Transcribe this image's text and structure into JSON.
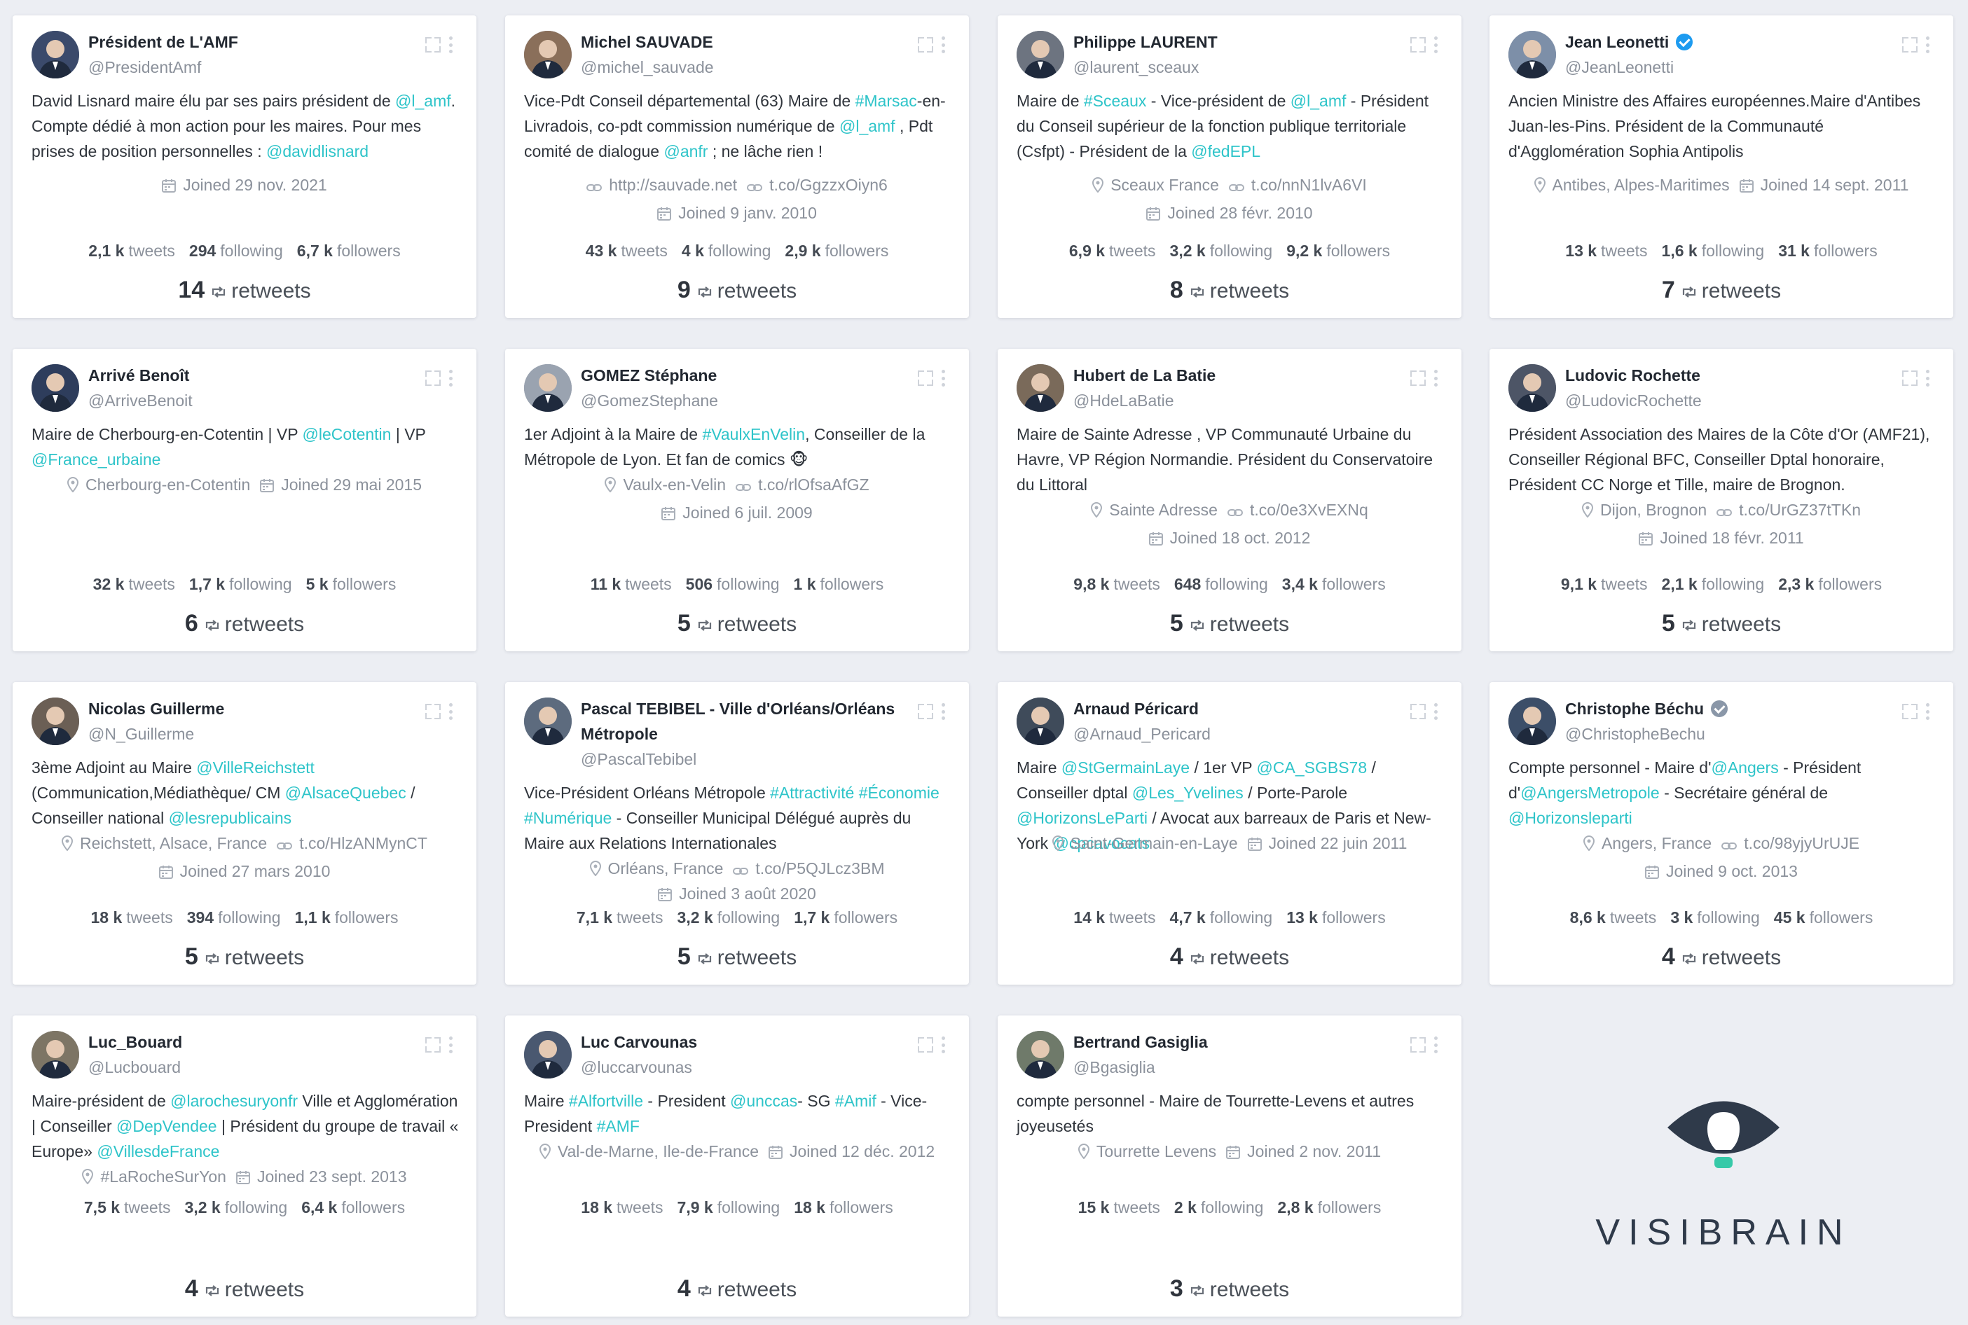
{
  "colors": {
    "background": "#eceef3",
    "card": "#ffffff",
    "highlight": "#2ec4c9",
    "muted": "#8b919b",
    "verified_blue": "#1d9bf0",
    "verified_gray": "#8a97a8"
  },
  "icons": {
    "card_actions": [
      "expand-icon",
      "more-icon"
    ],
    "location": "pin-icon",
    "url": "link-icon",
    "joined": "calendar-icon",
    "retweets": "retweet-icon"
  },
  "labels": {
    "tweets": "tweets",
    "following": "following",
    "followers": "followers",
    "retweets": "retweets"
  },
  "cards": [
    {
      "name": "Président de L'AMF",
      "verified": "",
      "handle": "@PresidentAmf",
      "bio": [
        {
          "t": "David Lisnard maire élu par ses pairs président de "
        },
        {
          "t": "@l_amf",
          "h": 1
        },
        {
          "t": ". Compte dédié à mon action pour les maires. Pour mes prises de position personnelles : "
        },
        {
          "t": "@davidlisnard",
          "h": 1
        }
      ],
      "location": "",
      "url": "",
      "joined": "Joined 29 nov. 2021",
      "tweets": "2,1 k",
      "following": "294",
      "followers": "6,7 k",
      "retweets": "14"
    },
    {
      "name": "Michel SAUVADE",
      "verified": "",
      "handle": "@michel_sauvade",
      "bio": [
        {
          "t": "Vice-Pdt Conseil départemental (63) Maire de "
        },
        {
          "t": "#Marsac",
          "h": 1
        },
        {
          "t": "-en-Livradois, co-pdt commission numérique de "
        },
        {
          "t": "@l_amf",
          "h": 1
        },
        {
          "t": " , Pdt comité de dialogue "
        },
        {
          "t": "@anfr",
          "h": 1
        },
        {
          "t": " ; ne lâche rien !"
        }
      ],
      "location": "",
      "url": "http://sauvade.net",
      "url2": "t.co/GgzzxOiyn6",
      "joined": "Joined 9 janv. 2010",
      "tweets": "43 k",
      "following": "4 k",
      "followers": "2,9 k",
      "retweets": "9"
    },
    {
      "name": "Philippe LAURENT",
      "verified": "",
      "handle": "@laurent_sceaux",
      "bio": [
        {
          "t": "Maire de "
        },
        {
          "t": "#Sceaux",
          "h": 1
        },
        {
          "t": " - Vice-président de "
        },
        {
          "t": "@l_amf",
          "h": 1
        },
        {
          "t": " - Président du Conseil supérieur de la fonction publique territoriale (Csfpt) - Président de la "
        },
        {
          "t": "@fedEPL",
          "h": 1
        }
      ],
      "location": "Sceaux France",
      "url": "t.co/nnN1lvA6VI",
      "joined": "Joined 28 févr. 2010",
      "tweets": "6,9 k",
      "following": "3,2 k",
      "followers": "9,2 k",
      "retweets": "8"
    },
    {
      "name": "Jean Leonetti",
      "verified": "blue",
      "handle": "@JeanLeonetti",
      "bio": [
        {
          "t": "Ancien Ministre des Affaires européennes.Maire d'Antibes Juan-les-Pins. Président de la Communauté d'Agglomération Sophia Antipolis"
        }
      ],
      "location": "Antibes, Alpes-Maritimes",
      "url": "",
      "joined": "Joined 14 sept. 2011",
      "tweets": "13 k",
      "following": "1,6 k",
      "followers": "31 k",
      "retweets": "7"
    },
    {
      "name": "Arrivé Benoît",
      "verified": "",
      "handle": "@ArriveBenoit",
      "bio": [
        {
          "t": "Maire de Cherbourg-en-Cotentin | VP "
        },
        {
          "t": "@leCotentin",
          "h": 1
        },
        {
          "t": " | VP "
        },
        {
          "t": "@France_urbaine",
          "h": 1
        }
      ],
      "location": "Cherbourg-en-Cotentin",
      "url": "",
      "joined": "Joined 29 mai 2015",
      "tweets": "32 k",
      "following": "1,7 k",
      "followers": "5 k",
      "retweets": "6"
    },
    {
      "name": "GOMEZ Stéphane",
      "verified": "",
      "handle": "@GomezStephane",
      "bio": [
        {
          "t": "1er Adjoint à la Maire de "
        },
        {
          "t": "#VaulxEnVelin",
          "h": 1
        },
        {
          "t": ", Conseiller de la Métropole de Lyon. Et fan de comics 🐵"
        }
      ],
      "location": "Vaulx-en-Velin",
      "url": "t.co/rlOfsaAfGZ",
      "joined": "Joined 6 juil. 2009",
      "tweets": "11 k",
      "following": "506",
      "followers": "1 k",
      "retweets": "5"
    },
    {
      "name": "Hubert de La Batie",
      "verified": "",
      "handle": "@HdeLaBatie",
      "bio": [
        {
          "t": "Maire de Sainte Adresse , VP Communauté Urbaine du Havre, VP Région Normandie. Président du Conservatoire du Littoral"
        }
      ],
      "location": "Sainte Adresse",
      "url": "t.co/0e3XvEXNq",
      "joined": "Joined 18 oct. 2012",
      "tweets": "9,8 k",
      "following": "648",
      "followers": "3,4 k",
      "retweets": "5"
    },
    {
      "name": "Ludovic Rochette",
      "verified": "",
      "handle": "@LudovicRochette",
      "bio": [
        {
          "t": "Président Association des Maires de la Côte d'Or (AMF21), Conseiller Régional BFC, Conseiller Dptal honoraire, Président CC Norge et Tille, maire de Brognon."
        }
      ],
      "location": "Dijon, Brognon",
      "url": "t.co/UrGZ37tTKn",
      "joined": "Joined 18 févr. 2011",
      "tweets": "9,1 k",
      "following": "2,1 k",
      "followers": "2,3 k",
      "retweets": "5"
    },
    {
      "name": "Nicolas Guillerme",
      "verified": "",
      "handle": "@N_Guillerme",
      "bio": [
        {
          "t": "3ème Adjoint au Maire "
        },
        {
          "t": "@VilleReichstett",
          "h": 1
        },
        {
          "t": " (Communication,Médiathèque/ CM "
        },
        {
          "t": "@AlsaceQuebec",
          "h": 1
        },
        {
          "t": " / Conseiller national "
        },
        {
          "t": "@lesrepublicains",
          "h": 1
        }
      ],
      "location": "Reichstett, Alsace, France",
      "url": "t.co/HlzANMynCT",
      "joined": "Joined 27 mars 2010",
      "tweets": "18 k",
      "following": "394",
      "followers": "1,1 k",
      "retweets": "5"
    },
    {
      "name": "Pascal TEBIBEL - Ville d'Orléans/Orléans Métropole",
      "verified": "",
      "handle": "@PascalTebibel",
      "bio": [
        {
          "t": "Vice-Président Orléans Métropole "
        },
        {
          "t": "#Attractivité",
          "h": 1
        },
        {
          "t": " "
        },
        {
          "t": "#Économie",
          "h": 1
        },
        {
          "t": " "
        },
        {
          "t": "#Numérique",
          "h": 1
        },
        {
          "t": " - Conseiller Municipal Délégué auprès du Maire aux Relations Internationales"
        }
      ],
      "location": "Orléans, France",
      "url": "t.co/P5QJLcz3BM",
      "joined": "Joined 3 août 2020",
      "tweets": "7,1 k",
      "following": "3,2 k",
      "followers": "1,7 k",
      "retweets": "5"
    },
    {
      "name": "Arnaud Péricard",
      "verified": "",
      "handle": "@Arnaud_Pericard",
      "bio": [
        {
          "t": "Maire "
        },
        {
          "t": "@StGermainLaye",
          "h": 1
        },
        {
          "t": " / 1er VP "
        },
        {
          "t": "@CA_SGBS78",
          "h": 1
        },
        {
          "t": " / Conseiller dptal "
        },
        {
          "t": "@Les_Yvelines",
          "h": 1
        },
        {
          "t": " / Porte-Parole "
        },
        {
          "t": "@HorizonsLeParti",
          "h": 1
        },
        {
          "t": " / Avocat aux barreaux de Paris et New-York "
        },
        {
          "t": "@cpcavocats",
          "h": 1
        }
      ],
      "location": "Saint-Germain-en-Laye",
      "url": "",
      "joined": "Joined 22 juin 2011",
      "tweets": "14 k",
      "following": "4,7 k",
      "followers": "13 k",
      "retweets": "4"
    },
    {
      "name": "Christophe Béchu",
      "verified": "gray",
      "handle": "@ChristopheBechu",
      "bio": [
        {
          "t": "Compte personnel - Maire d'"
        },
        {
          "t": "@Angers",
          "h": 1
        },
        {
          "t": " - Président d'"
        },
        {
          "t": "@AngersMetropole",
          "h": 1
        },
        {
          "t": " - Secrétaire général de "
        },
        {
          "t": "@Horizonsleparti",
          "h": 1
        }
      ],
      "location": "Angers, France",
      "url": "t.co/98yjyUrUJE",
      "joined": "Joined 9 oct. 2013",
      "tweets": "8,6 k",
      "following": "3 k",
      "followers": "45 k",
      "retweets": "4"
    },
    {
      "name": "Luc_Bouard",
      "verified": "",
      "handle": "@Lucbouard",
      "bio": [
        {
          "t": "Maire-président de "
        },
        {
          "t": "@larochesuryonfr",
          "h": 1
        },
        {
          "t": " Ville et Agglomération | Conseiller "
        },
        {
          "t": "@DepVendee",
          "h": 1
        },
        {
          "t": " | Président du groupe de travail « Europe» "
        },
        {
          "t": "@VillesdeFrance",
          "h": 1
        }
      ],
      "location": "#LaRocheSurYon",
      "url": "",
      "joined": "Joined 23 sept. 2013",
      "tweets": "7,5 k",
      "following": "3,2 k",
      "followers": "6,4 k",
      "retweets": "4"
    },
    {
      "name": "Luc Carvounas",
      "verified": "",
      "handle": "@luccarvounas",
      "bio": [
        {
          "t": "Maire "
        },
        {
          "t": "#Alfortville",
          "h": 1
        },
        {
          "t": " - President "
        },
        {
          "t": "@unccas",
          "h": 1
        },
        {
          "t": "- SG "
        },
        {
          "t": "#Amif",
          "h": 1
        },
        {
          "t": " - Vice-President "
        },
        {
          "t": "#AMF",
          "h": 1
        }
      ],
      "location": "Val-de-Marne, Ile-de-France",
      "url": "",
      "joined": "Joined 12 déc. 2012",
      "tweets": "18 k",
      "following": "7,9 k",
      "followers": "18 k",
      "retweets": "4"
    },
    {
      "name": "Bertrand Gasiglia",
      "verified": "",
      "handle": "@Bgasiglia",
      "bio": [
        {
          "t": "compte personnel - Maire de Tourrette-Levens et autres joyeusetés"
        }
      ],
      "location": "Tourrette Levens",
      "url": "",
      "joined": "Joined 2 nov. 2011",
      "tweets": "15 k",
      "following": "2 k",
      "followers": "2,8 k",
      "retweets": "3"
    }
  ],
  "brand": {
    "name": "VISIBRAIN"
  }
}
